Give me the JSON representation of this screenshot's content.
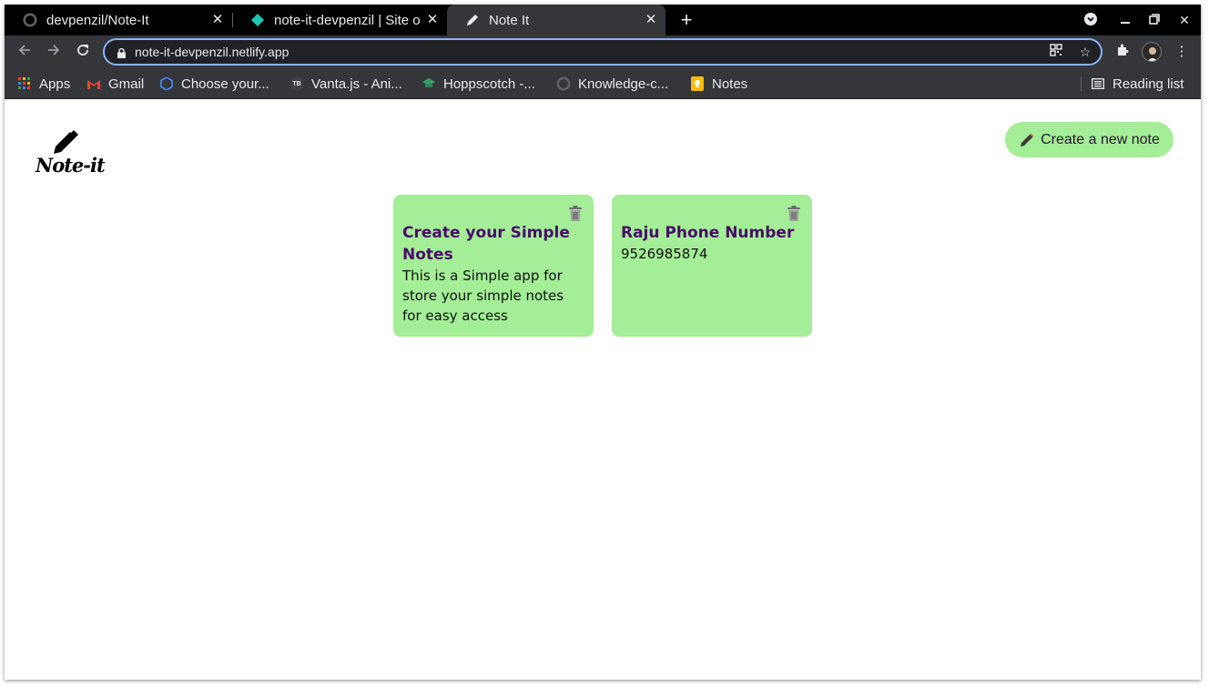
{
  "browser": {
    "tabs": [
      {
        "title": "devpenzil/Note-It",
        "icon": "github-icon",
        "active": false
      },
      {
        "title": "note-it-devpenzil | Site o",
        "icon": "netlify-icon",
        "active": false
      },
      {
        "title": "Note It",
        "icon": "pencil-icon",
        "active": true
      }
    ],
    "url": "note-it-devpenzil.netlify.app",
    "bookmarks": [
      {
        "label": "Apps",
        "icon": "apps-grid-icon"
      },
      {
        "label": "Gmail",
        "icon": "gmail-icon"
      },
      {
        "label": "Choose your...",
        "icon": "cube-icon"
      },
      {
        "label": "Vanta.js - Ani...",
        "icon": "tb-icon",
        "icon_text": "TB"
      },
      {
        "label": "Hoppscotch -...",
        "icon": "hoppscotch-icon"
      },
      {
        "label": "Knowledge-c...",
        "icon": "github-icon"
      },
      {
        "label": "Notes",
        "icon": "keep-icon"
      }
    ],
    "reading_list": "Reading list"
  },
  "app": {
    "logo_text": "Note-it",
    "create_button_label": "Create a new note",
    "notes": [
      {
        "title": "Create your Simple Notes",
        "body": "This is a Simple app for store your simple notes for easy access"
      },
      {
        "title": "Raju Phone Number",
        "body": "9526985874"
      }
    ]
  },
  "colors": {
    "note_bg": "#a3ee96",
    "note_title": "#4b0a6b",
    "browser_dark": "#35363a",
    "accent_focus": "#8ab4f8"
  }
}
